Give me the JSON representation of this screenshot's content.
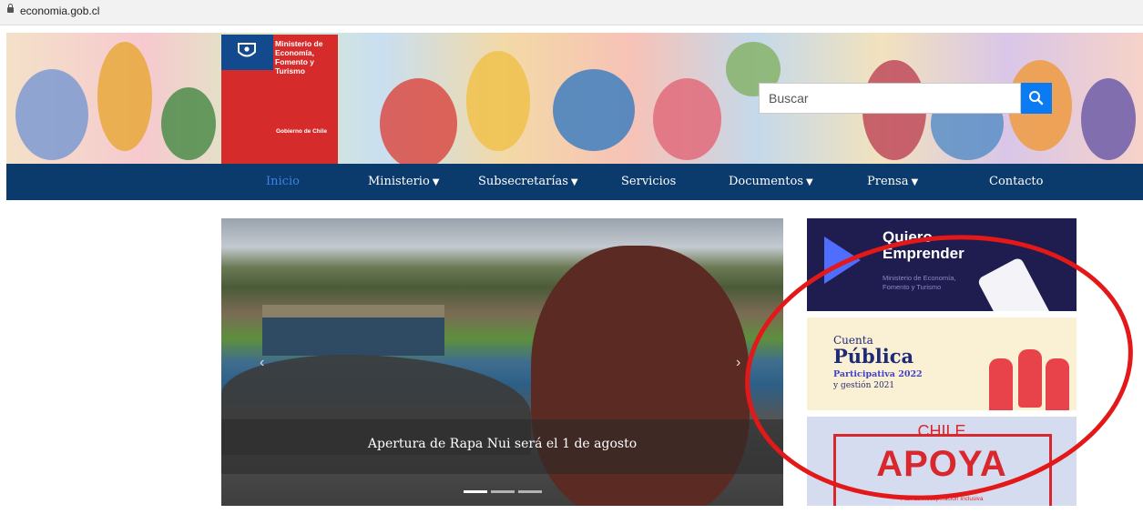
{
  "browser": {
    "url": "economia.gob.cl"
  },
  "logo": {
    "ministry_lines": [
      "Ministerio de",
      "Economía,",
      "Fomento y",
      "Turismo"
    ],
    "gobierno": "Gobierno de Chile"
  },
  "search": {
    "placeholder": "Buscar"
  },
  "nav": {
    "items": [
      {
        "label": "Inicio",
        "active": true,
        "dropdown": false
      },
      {
        "label": "Ministerio",
        "active": false,
        "dropdown": true
      },
      {
        "label": "Subsecretarías",
        "active": false,
        "dropdown": true
      },
      {
        "label": "Servicios",
        "active": false,
        "dropdown": false
      },
      {
        "label": "Documentos",
        "active": false,
        "dropdown": true
      },
      {
        "label": "Prensa",
        "active": false,
        "dropdown": true
      },
      {
        "label": "Contacto",
        "active": false,
        "dropdown": false
      }
    ]
  },
  "slider": {
    "caption": "Apertura de Rapa Nui será el 1 de agosto",
    "slide_count": 3,
    "active_slide": 1
  },
  "banners": {
    "quiero": {
      "line1": "Quiero",
      "line2": "Emprender",
      "sub1": "Ministerio de Economía,",
      "sub2": "Fomento y Turismo"
    },
    "cuenta": {
      "line1": "Cuenta",
      "line2": "Pública",
      "line3": "Participativa 2022",
      "line4": "y gestión 2021"
    },
    "apoya": {
      "line1": "CHILE",
      "line2": "APOYA",
      "line3": "Plan de Recuperación Inclusiva"
    }
  },
  "colors": {
    "nav_bg": "#0b3a6c",
    "nav_active": "#3d83e0",
    "search_button": "#0a7bf2",
    "annotation_ring": "#e31818"
  }
}
